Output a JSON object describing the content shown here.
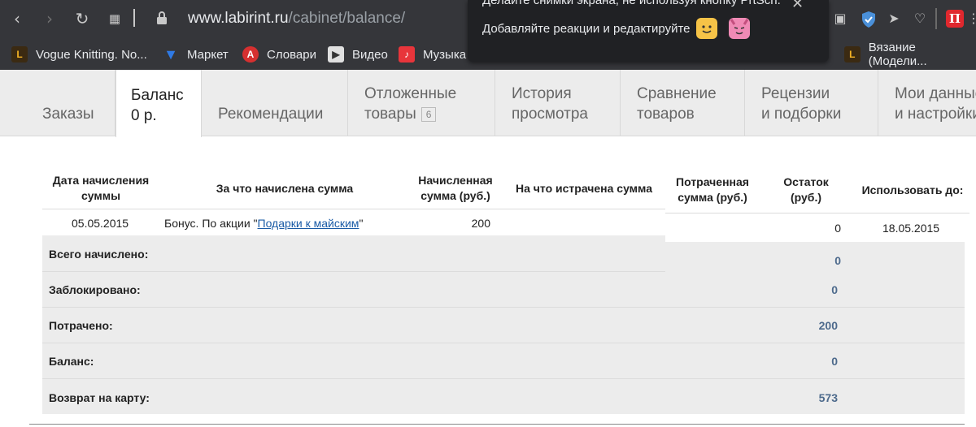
{
  "browser": {
    "url_host": "www.labirint.ru",
    "url_path": "/cabinet/balance/",
    "bookmarks": [
      {
        "label": "Vogue Knitting. No..."
      },
      {
        "label": "Маркет"
      },
      {
        "label": "Словари"
      },
      {
        "label": "Видео"
      },
      {
        "label": "Музыка"
      },
      {
        "label": "Вязание (Модели..."
      }
    ]
  },
  "popup": {
    "line1": "Делайте снимки экрана, не используя кнопку PrtScn.",
    "line2": "Добавляйте реакции и редактируйте"
  },
  "tabs": [
    {
      "line1": "Заказы",
      "line2": ""
    },
    {
      "line1": "Баланс",
      "line2": "0 р."
    },
    {
      "line1": "Рекомендации",
      "line2": ""
    },
    {
      "line1": "Отложенные",
      "line2": "товары",
      "badge": "6"
    },
    {
      "line1": "История",
      "line2": "просмотра"
    },
    {
      "line1": "Сравнение",
      "line2": "товаров"
    },
    {
      "line1": "Рецензии",
      "line2": "и подборки"
    },
    {
      "line1": "Мои данные",
      "line2": "и настройки"
    }
  ],
  "table": {
    "headers": {
      "date": [
        "Дата начисления",
        "суммы"
      ],
      "reason": "За что начислена сумма",
      "accrued": [
        "Начисленная",
        "сумма (руб.)"
      ],
      "spent_on": "На что истрачена сумма",
      "spent": [
        "Потраченная",
        "сумма (руб.)"
      ],
      "rest": [
        "Остаток",
        "(руб.)"
      ],
      "valid_until": "Использовать до:"
    },
    "row": {
      "date": "05.05.2015",
      "reason_prefix": "Бонус. По акции \"",
      "reason_link": "Подарки к майским",
      "reason_suffix": "\"",
      "accrued": "200",
      "rest": "0",
      "valid_until": "18.05.2015"
    }
  },
  "summary": [
    {
      "label": "Всего начислено:",
      "value": "0"
    },
    {
      "label": "Заблокировано:",
      "value": "0"
    },
    {
      "label": "Потрачено:",
      "value": "200"
    },
    {
      "label": "Баланс:",
      "value": "0"
    },
    {
      "label": "Возврат на карту:",
      "value": "573"
    }
  ]
}
